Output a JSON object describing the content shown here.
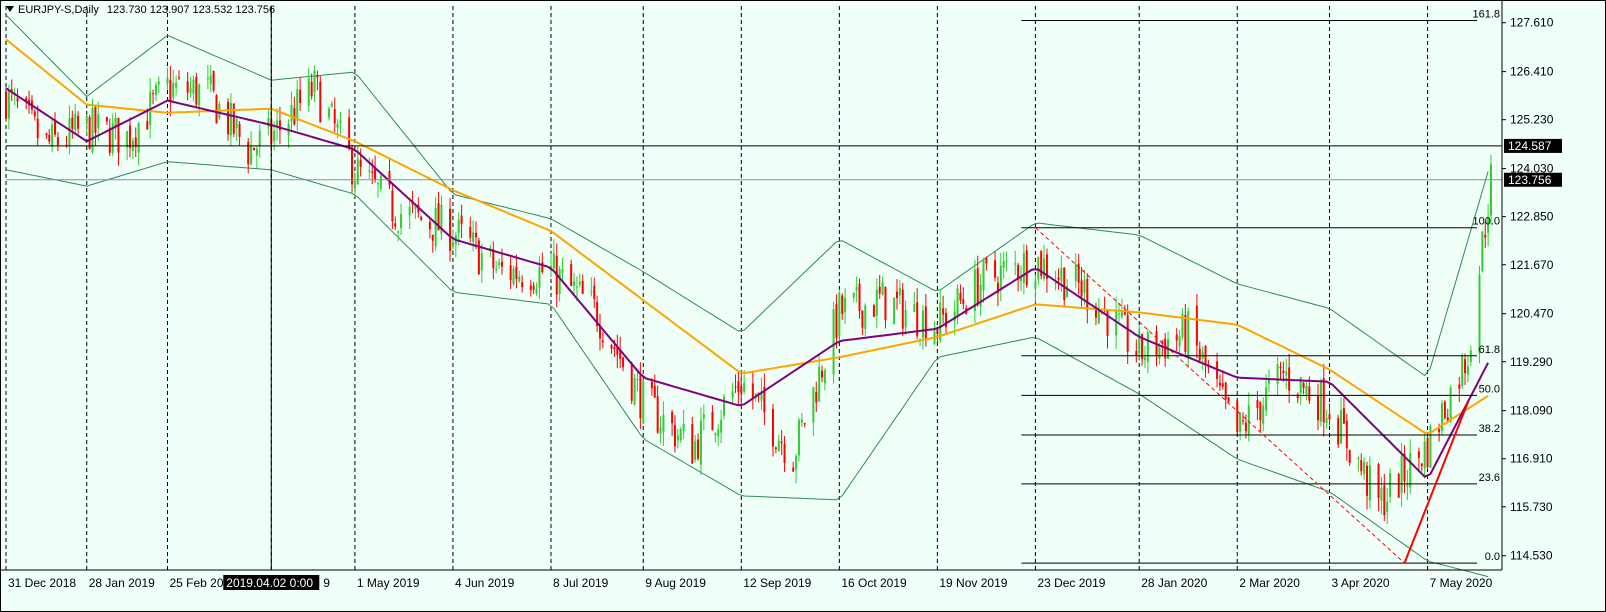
{
  "header": {
    "symbol": "EURJPY-S,Daily",
    "ohlc": "123.730 123.907 123.532 123.756"
  },
  "crosshair": {
    "label": "2019.04.02 0:00"
  },
  "colors": {
    "background": "#f0fff8",
    "bull": "#32cd32",
    "bear": "#ff0000",
    "ma_fast": "#800080",
    "ma_slow": "#ffa500",
    "bands": "#2e8b57",
    "fib": "#000000",
    "trend": "#ff0000"
  },
  "chart_data": {
    "type": "line",
    "title": "",
    "y_axis": {
      "ticks": [
        127.61,
        126.41,
        125.23,
        124.03,
        122.85,
        121.67,
        120.47,
        119.29,
        118.09,
        116.91,
        115.73,
        114.53
      ],
      "tick_labels": [
        "127.610",
        "126.410",
        "125.230",
        "124.030",
        "122.850",
        "121.670",
        "120.470",
        "119.290",
        "118.090",
        "116.910",
        "115.730",
        "114.530"
      ],
      "range": [
        114.18,
        128.02
      ]
    },
    "x_axis": {
      "labels": [
        "31 Dec 2018",
        "28 Jan 2019",
        "25 Feb 2019",
        "2 Apr 2019",
        "1 May 2019",
        "4 Jun 2019",
        "8 Jul 2019",
        "9 Aug 2019",
        "12 Sep 2019",
        "16 Oct 2019",
        "19 Nov 2019",
        "23 Dec 2019",
        "28 Jan 2020",
        "2 Mar 2020",
        "3 Apr 2020",
        "7 May 2020"
      ],
      "visible_text": [
        "31 Dec 2018",
        "28 Jan 2019",
        "25 Feb 20",
        "",
        "9",
        "1 May 2019",
        "4 Jun 2019",
        "8 Jul 2019",
        "9 Aug 2019",
        "12 Sep 2019",
        "16 Oct 2019",
        "19 Nov 2019",
        "23 Dec 2019",
        "28 Jan 2020",
        "2 Mar 2020",
        "3 Apr 2020",
        "7 May 2020"
      ]
    },
    "grid": "vertical-dashed",
    "horizontal_levels": [
      {
        "price": 124.587,
        "label": "124.587"
      },
      {
        "price": 123.756,
        "label": "123.756"
      }
    ],
    "fibonacci": {
      "low": 114.35,
      "high": 122.58,
      "levels": [
        {
          "ratio": 161.8,
          "label": "161.8",
          "price": 127.665
        },
        {
          "ratio": 100.0,
          "label": "100.0",
          "price": 122.58
        },
        {
          "ratio": 61.8,
          "label": "61.8",
          "price": 119.436
        },
        {
          "ratio": 50.0,
          "label": "50.0",
          "price": 118.465
        },
        {
          "ratio": 38.2,
          "label": "38.2",
          "price": 117.494
        },
        {
          "ratio": 23.6,
          "label": "23.6",
          "price": 116.292
        },
        {
          "ratio": 0.0,
          "label": "0.0",
          "price": 114.35
        }
      ]
    },
    "series": [
      {
        "role": "close",
        "points": [
          [
            "31 Dec 2018",
            125.8
          ],
          [
            "14 Jan 2019",
            124.6
          ],
          [
            "28 Jan 2019",
            125.0
          ],
          [
            "11 Feb 2019",
            124.8
          ],
          [
            "25 Feb 2019",
            126.0
          ],
          [
            "11 Mar 2019",
            125.9
          ],
          [
            "25 Mar 2019",
            124.5
          ],
          [
            "2 Apr 2019",
            124.8
          ],
          [
            "17 Apr 2019",
            126.0
          ],
          [
            "1 May 2019",
            124.0
          ],
          [
            "15 May 2019",
            123.0
          ],
          [
            "4 Jun 2019",
            122.5
          ],
          [
            "20 Jun 2019",
            121.5
          ],
          [
            "8 Jul 2019",
            121.5
          ],
          [
            "24 Jul 2019",
            120.5
          ],
          [
            "9 Aug 2019",
            118.3
          ],
          [
            "26 Aug 2019",
            117.2
          ],
          [
            "12 Sep 2019",
            118.8
          ],
          [
            "30 Sep 2019",
            117.0
          ],
          [
            "16 Oct 2019",
            120.5
          ],
          [
            "31 Oct 2019",
            120.8
          ],
          [
            "19 Nov 2019",
            120.2
          ],
          [
            "5 Dec 2019",
            121.3
          ],
          [
            "23 Dec 2019",
            121.8
          ],
          [
            "10 Jan 2020",
            121.0
          ],
          [
            "28 Jan 2020",
            119.5
          ],
          [
            "14 Feb 2020",
            120.0
          ],
          [
            "2 Mar 2020",
            117.5
          ],
          [
            "18 Mar 2020",
            119.0
          ],
          [
            "3 Apr 2020",
            118.2
          ],
          [
            "20 Apr 2020",
            115.8
          ],
          [
            "7 May 2020",
            117.2
          ],
          [
            "21 May 2020",
            119.5
          ],
          [
            "29 May 2020",
            123.756
          ]
        ]
      },
      {
        "role": "fast-ma",
        "points": [
          [
            "31 Dec 2018",
            126.0
          ],
          [
            "28 Jan 2019",
            124.7
          ],
          [
            "25 Feb 2019",
            125.7
          ],
          [
            "2 Apr 2019",
            125.1
          ],
          [
            "1 May 2019",
            124.5
          ],
          [
            "4 Jun 2019",
            122.3
          ],
          [
            "8 Jul 2019",
            121.6
          ],
          [
            "9 Aug 2019",
            118.9
          ],
          [
            "12 Sep 2019",
            118.2
          ],
          [
            "16 Oct 2019",
            119.8
          ],
          [
            "19 Nov 2019",
            120.1
          ],
          [
            "23 Dec 2019",
            121.6
          ],
          [
            "28 Jan 2020",
            119.9
          ],
          [
            "2 Mar 2020",
            118.9
          ],
          [
            "3 Apr 2020",
            118.8
          ],
          [
            "7 May 2020",
            116.4
          ],
          [
            "29 May 2020",
            119.4
          ]
        ]
      },
      {
        "role": "slow-ma",
        "points": [
          [
            "31 Dec 2018",
            127.2
          ],
          [
            "28 Jan 2019",
            125.6
          ],
          [
            "25 Feb 2019",
            125.4
          ],
          [
            "2 Apr 2019",
            125.5
          ],
          [
            "1 May 2019",
            124.7
          ],
          [
            "4 Jun 2019",
            123.5
          ],
          [
            "8 Jul 2019",
            122.5
          ],
          [
            "9 Aug 2019",
            120.8
          ],
          [
            "12 Sep 2019",
            119.0
          ],
          [
            "16 Oct 2019",
            119.4
          ],
          [
            "19 Nov 2019",
            119.9
          ],
          [
            "23 Dec 2019",
            120.7
          ],
          [
            "28 Jan 2020",
            120.5
          ],
          [
            "2 Mar 2020",
            120.2
          ],
          [
            "3 Apr 2020",
            119.1
          ],
          [
            "7 May 2020",
            117.5
          ],
          [
            "29 May 2020",
            118.5
          ]
        ]
      },
      {
        "role": "upper-band",
        "points": [
          [
            "31 Dec 2018",
            127.8
          ],
          [
            "28 Jan 2019",
            125.8
          ],
          [
            "25 Feb 2019",
            127.3
          ],
          [
            "2 Apr 2019",
            126.2
          ],
          [
            "1 May 2019",
            126.4
          ],
          [
            "4 Jun 2019",
            123.4
          ],
          [
            "8 Jul 2019",
            122.8
          ],
          [
            "9 Aug 2019",
            121.5
          ],
          [
            "12 Sep 2019",
            120.0
          ],
          [
            "16 Oct 2019",
            122.3
          ],
          [
            "19 Nov 2019",
            121.0
          ],
          [
            "23 Dec 2019",
            122.7
          ],
          [
            "28 Jan 2020",
            122.4
          ],
          [
            "2 Mar 2020",
            121.2
          ],
          [
            "3 Apr 2020",
            120.6
          ],
          [
            "7 May 2020",
            118.9
          ],
          [
            "29 May 2020",
            124.2
          ]
        ]
      },
      {
        "role": "lower-band",
        "points": [
          [
            "31 Dec 2018",
            124.0
          ],
          [
            "28 Jan 2019",
            123.6
          ],
          [
            "25 Feb 2019",
            124.2
          ],
          [
            "2 Apr 2019",
            124.0
          ],
          [
            "1 May 2019",
            123.4
          ],
          [
            "4 Jun 2019",
            121.0
          ],
          [
            "8 Jul 2019",
            120.7
          ],
          [
            "9 Aug 2019",
            117.4
          ],
          [
            "12 Sep 2019",
            116.0
          ],
          [
            "16 Oct 2019",
            115.9
          ],
          [
            "19 Nov 2019",
            119.4
          ],
          [
            "23 Dec 2019",
            119.9
          ],
          [
            "28 Jan 2020",
            118.5
          ],
          [
            "2 Mar 2020",
            116.9
          ],
          [
            "3 Apr 2020",
            116.1
          ],
          [
            "7 May 2020",
            114.4
          ],
          [
            "29 May 2020",
            114.0
          ]
        ]
      }
    ],
    "trendlines": [
      {
        "style": "dashed",
        "from": [
          "23 Dec 2019",
          122.58
        ],
        "to": [
          "29 Apr 2020",
          114.35
        ]
      },
      {
        "style": "solid",
        "from": [
          "29 Apr 2020",
          114.35
        ],
        "to": [
          "21 May 2020",
          118.3
        ]
      }
    ]
  }
}
